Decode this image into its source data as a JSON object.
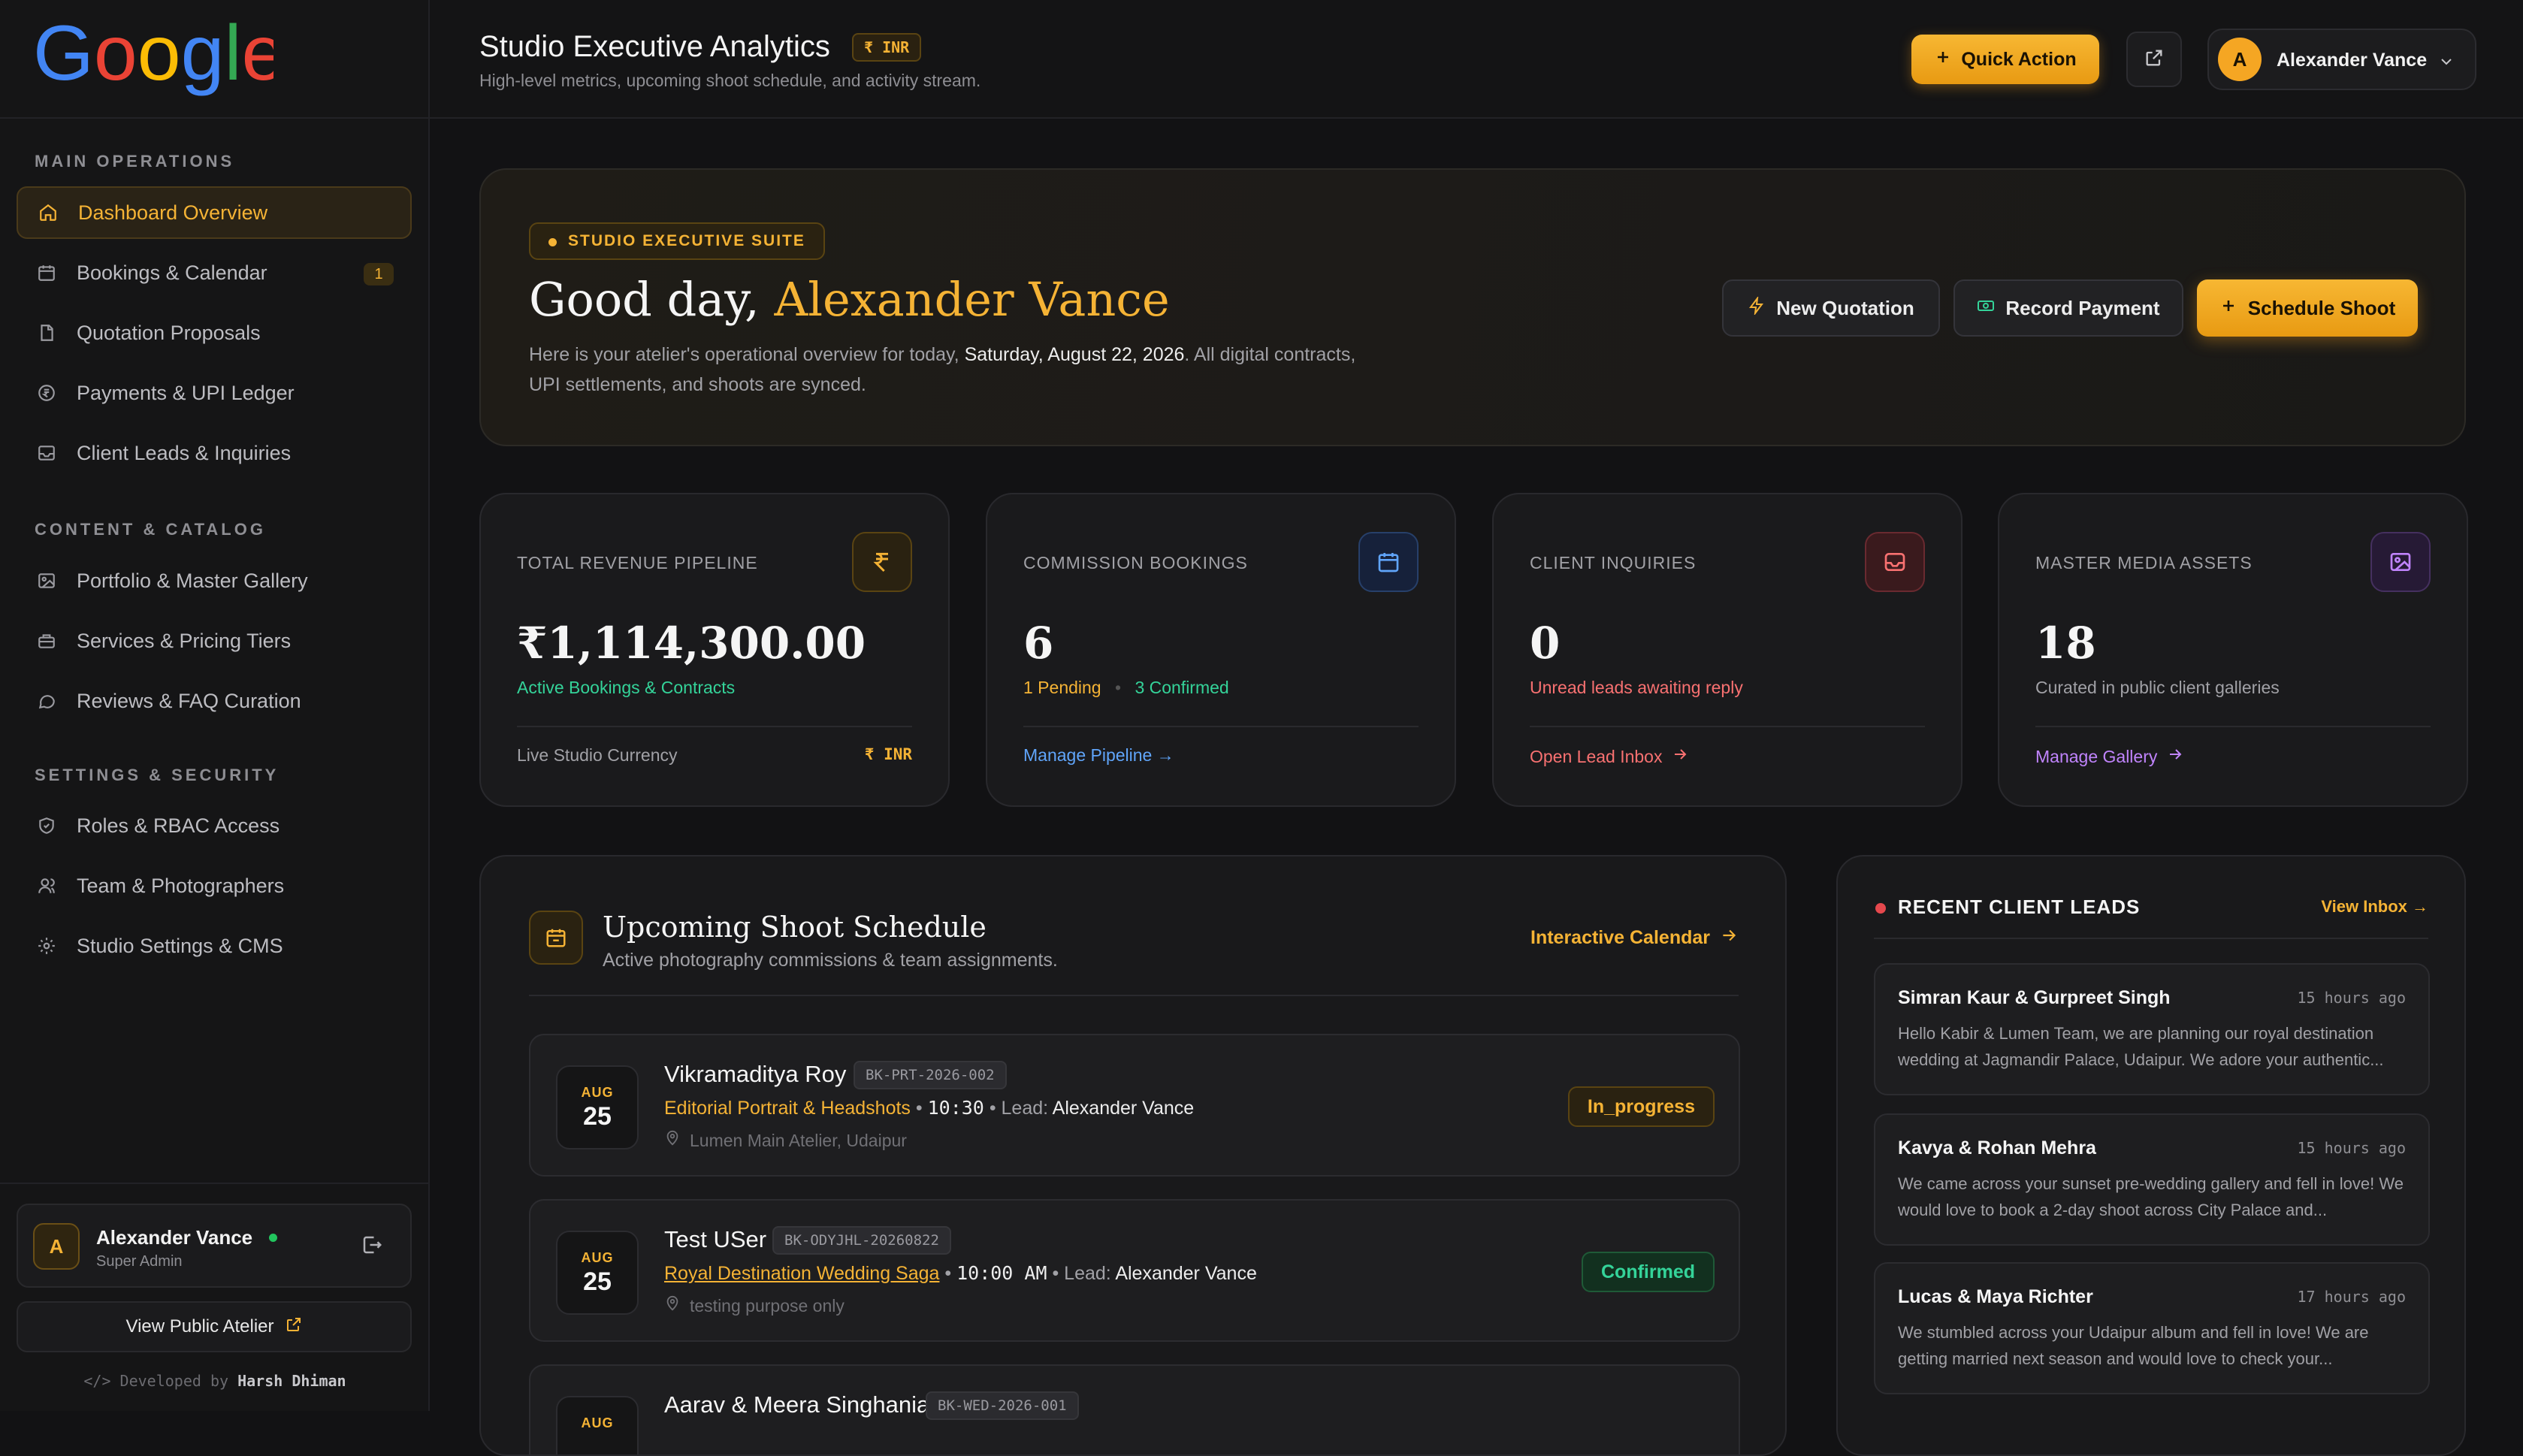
{
  "brand": {
    "logo_text": "Google"
  },
  "sidebar": {
    "sections": [
      {
        "title": "MAIN OPERATIONS"
      },
      {
        "title": "CONTENT & CATALOG"
      },
      {
        "title": "SETTINGS & SECURITY"
      }
    ],
    "items": [
      {
        "label": "Dashboard Overview",
        "icon": "home-icon"
      },
      {
        "label": "Bookings & Calendar",
        "icon": "calendar-icon",
        "badge": "1"
      },
      {
        "label": "Quotation Proposals",
        "icon": "document-icon"
      },
      {
        "label": "Payments & UPI Ledger",
        "icon": "currency-icon"
      },
      {
        "label": "Client Leads & Inquiries",
        "icon": "inbox-icon"
      },
      {
        "label": "Portfolio & Master Gallery",
        "icon": "image-icon"
      },
      {
        "label": "Services & Pricing Tiers",
        "icon": "briefcase-icon"
      },
      {
        "label": "Reviews & FAQ Curation",
        "icon": "chat-icon"
      },
      {
        "label": "Roles & RBAC Access",
        "icon": "shield-icon"
      },
      {
        "label": "Team & Photographers",
        "icon": "users-icon"
      },
      {
        "label": "Studio Settings & CMS",
        "icon": "gear-icon"
      }
    ],
    "user": {
      "initial": "A",
      "name": "Alexander Vance",
      "role": "Super Admin"
    },
    "view_public_label": "View Public Atelier",
    "credit_prefix": "</> Developed by",
    "credit_name": "Harsh Dhiman"
  },
  "header": {
    "title": "Studio Executive Analytics",
    "currency_badge": "₹ INR",
    "subtitle": "High-level metrics, upcoming shoot schedule, and activity stream.",
    "quick_action_label": "Quick Action",
    "user_initial": "A",
    "user_name": "Alexander Vance"
  },
  "hero": {
    "badge": "STUDIO EXECUTIVE SUITE",
    "greeting_prefix": "Good day,",
    "greeting_name": "Alexander Vance",
    "desc_before": "Here is your atelier's operational overview for today,",
    "desc_date": "Saturday, August 22, 2026",
    "desc_after": ". All digital contracts, UPI settlements, and shoots are synced.",
    "btn_quote": "New Quotation",
    "btn_record": "Record Payment",
    "btn_schedule": "Schedule Shoot"
  },
  "stats": [
    {
      "label": "TOTAL REVENUE PIPELINE",
      "value": "₹1,114,300.00",
      "sub": "Active Bookings & Contracts",
      "foot": "Live Studio Currency",
      "foot_right": "₹ INR",
      "icon": "rupee-icon"
    },
    {
      "label": "COMMISSION BOOKINGS",
      "value": "6",
      "sub_pending": "1 Pending",
      "sub_sep": "•",
      "sub_confirmed": "3 Confirmed",
      "foot": "Manage Pipeline →",
      "icon": "calendar-icon"
    },
    {
      "label": "CLIENT INQUIRIES",
      "value": "0",
      "sub": "Unread leads awaiting reply",
      "foot": "Open Lead Inbox",
      "icon": "inbox-icon"
    },
    {
      "label": "MASTER MEDIA ASSETS",
      "value": "18",
      "sub": "Curated in public client galleries",
      "foot": "Manage Gallery",
      "icon": "image-icon"
    }
  ],
  "schedule": {
    "title": "Upcoming Shoot Schedule",
    "subtitle": "Active photography commissions & team assignments.",
    "calendar_link": "Interactive Calendar",
    "bookings": [
      {
        "month": "AUG",
        "day": "25",
        "client": "Vikramaditya Roy",
        "id": "BK-PRT-2026-002",
        "service": "Editorial Portrait & Headshots",
        "time": "10:30",
        "lead_label": "Lead:",
        "lead": "Alexander Vance",
        "location": "Lumen Main Atelier, Udaipur",
        "status": "In_progress"
      },
      {
        "month": "AUG",
        "day": "25",
        "client": "Test USer",
        "id": "BK-ODYJHL-20260822",
        "service": "Royal Destination Wedding Saga",
        "time": "10:00 AM",
        "lead_label": "Lead:",
        "lead": "Alexander Vance",
        "location": "testing purpose only",
        "status": "Confirmed"
      },
      {
        "month": "AUG",
        "day": "",
        "client": "Aarav & Meera Singhania",
        "id": "BK-WED-2026-001",
        "service": "",
        "time": "",
        "lead_label": "",
        "lead": "",
        "location": "",
        "status": ""
      }
    ]
  },
  "leads": {
    "title": "RECENT CLIENT LEADS",
    "view_inbox": "View Inbox →",
    "items": [
      {
        "name": "Simran Kaur & Gurpreet Singh",
        "time": "15 hours ago",
        "message": "Hello Kabir & Lumen Team, we are planning our royal destination wedding at Jagmandir Palace, Udaipur. We adore your authentic..."
      },
      {
        "name": "Kavya & Rohan Mehra",
        "time": "15 hours ago",
        "message": "We came across your sunset pre-wedding gallery and fell in love! We would love to book a 2-day shoot across City Palace and..."
      },
      {
        "name": "Lucas & Maya Richter",
        "time": "17 hours ago",
        "message": "We stumbled across your Udaipur album and fell in love! We are getting married next season and would love to check your..."
      }
    ]
  }
}
